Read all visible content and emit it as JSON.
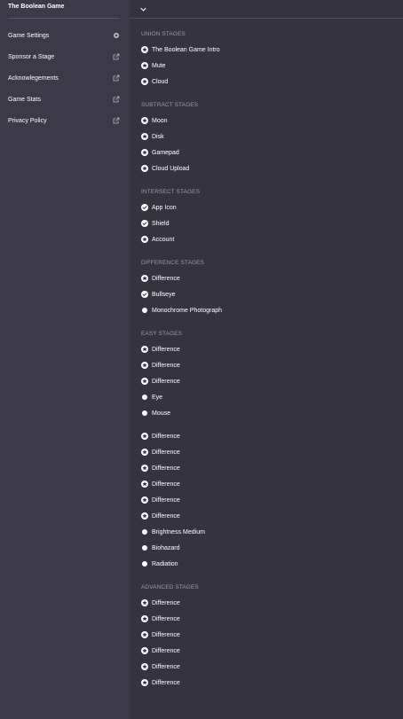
{
  "app": {
    "title": "The Boolean Game"
  },
  "sidebar": {
    "items": [
      {
        "label": "Game Settings",
        "icon": "gear-icon"
      },
      {
        "label": "Sponsor a Stage",
        "icon": "external-link-icon"
      },
      {
        "label": "Acknowlegements",
        "icon": "external-link-icon"
      },
      {
        "label": "Game Stats",
        "icon": "external-link-icon"
      },
      {
        "label": "Privacy Policy",
        "icon": "external-link-icon"
      }
    ]
  },
  "topbar": {
    "toggle_icon": "chevron-down-icon"
  },
  "sections": [
    {
      "title": "UNION STAGES",
      "stages": [
        {
          "label": "The Boolean Game Intro",
          "status": "star"
        },
        {
          "label": "Mute",
          "status": "star"
        },
        {
          "label": "Cloud",
          "status": "star"
        }
      ]
    },
    {
      "title": "SUBTRACT STAGES",
      "stages": [
        {
          "label": "Moon",
          "status": "star"
        },
        {
          "label": "Disk",
          "status": "star"
        },
        {
          "label": "Gamepad",
          "status": "star"
        },
        {
          "label": "Cloud Upload",
          "status": "star"
        }
      ]
    },
    {
      "title": "INTERSECT STAGES",
      "stages": [
        {
          "label": "App Icon",
          "status": "check"
        },
        {
          "label": "Shield",
          "status": "check"
        },
        {
          "label": "Account",
          "status": "star"
        }
      ]
    },
    {
      "title": "DIFFERENCE STAGES",
      "stages": [
        {
          "label": "Difference",
          "status": "star"
        },
        {
          "label": "Bullseye",
          "status": "check"
        },
        {
          "label": "Monochrome Photograph",
          "status": "dot"
        }
      ]
    },
    {
      "title": "EASY STAGES",
      "stages": [
        {
          "label": "Difference",
          "status": "star"
        },
        {
          "label": "Difference",
          "status": "star"
        },
        {
          "label": "Difference",
          "status": "star"
        },
        {
          "label": "Eye",
          "status": "dot"
        },
        {
          "label": "Mouse",
          "status": "dot"
        },
        {
          "label": "Difference",
          "status": "star"
        },
        {
          "label": "Difference",
          "status": "star"
        },
        {
          "label": "Difference",
          "status": "star"
        },
        {
          "label": "Difference",
          "status": "star"
        },
        {
          "label": "Difference",
          "status": "star"
        },
        {
          "label": "Difference",
          "status": "star"
        },
        {
          "label": "Brightness Medium",
          "status": "dot"
        },
        {
          "label": "Biohazard",
          "status": "dot"
        },
        {
          "label": "Radiation",
          "status": "dot"
        }
      ]
    },
    {
      "title": "ADVANCED STAGES",
      "stages": [
        {
          "label": "Difference",
          "status": "star"
        },
        {
          "label": "Difference",
          "status": "star"
        },
        {
          "label": "Difference",
          "status": "star"
        },
        {
          "label": "Difference",
          "status": "star"
        },
        {
          "label": "Difference",
          "status": "star"
        },
        {
          "label": "Difference",
          "status": "star"
        }
      ]
    }
  ],
  "colors": {
    "sidebar_bg": "#3c3948",
    "main_bg": "#363341",
    "header_text": "#9c99a8",
    "text": "#ffffff"
  }
}
